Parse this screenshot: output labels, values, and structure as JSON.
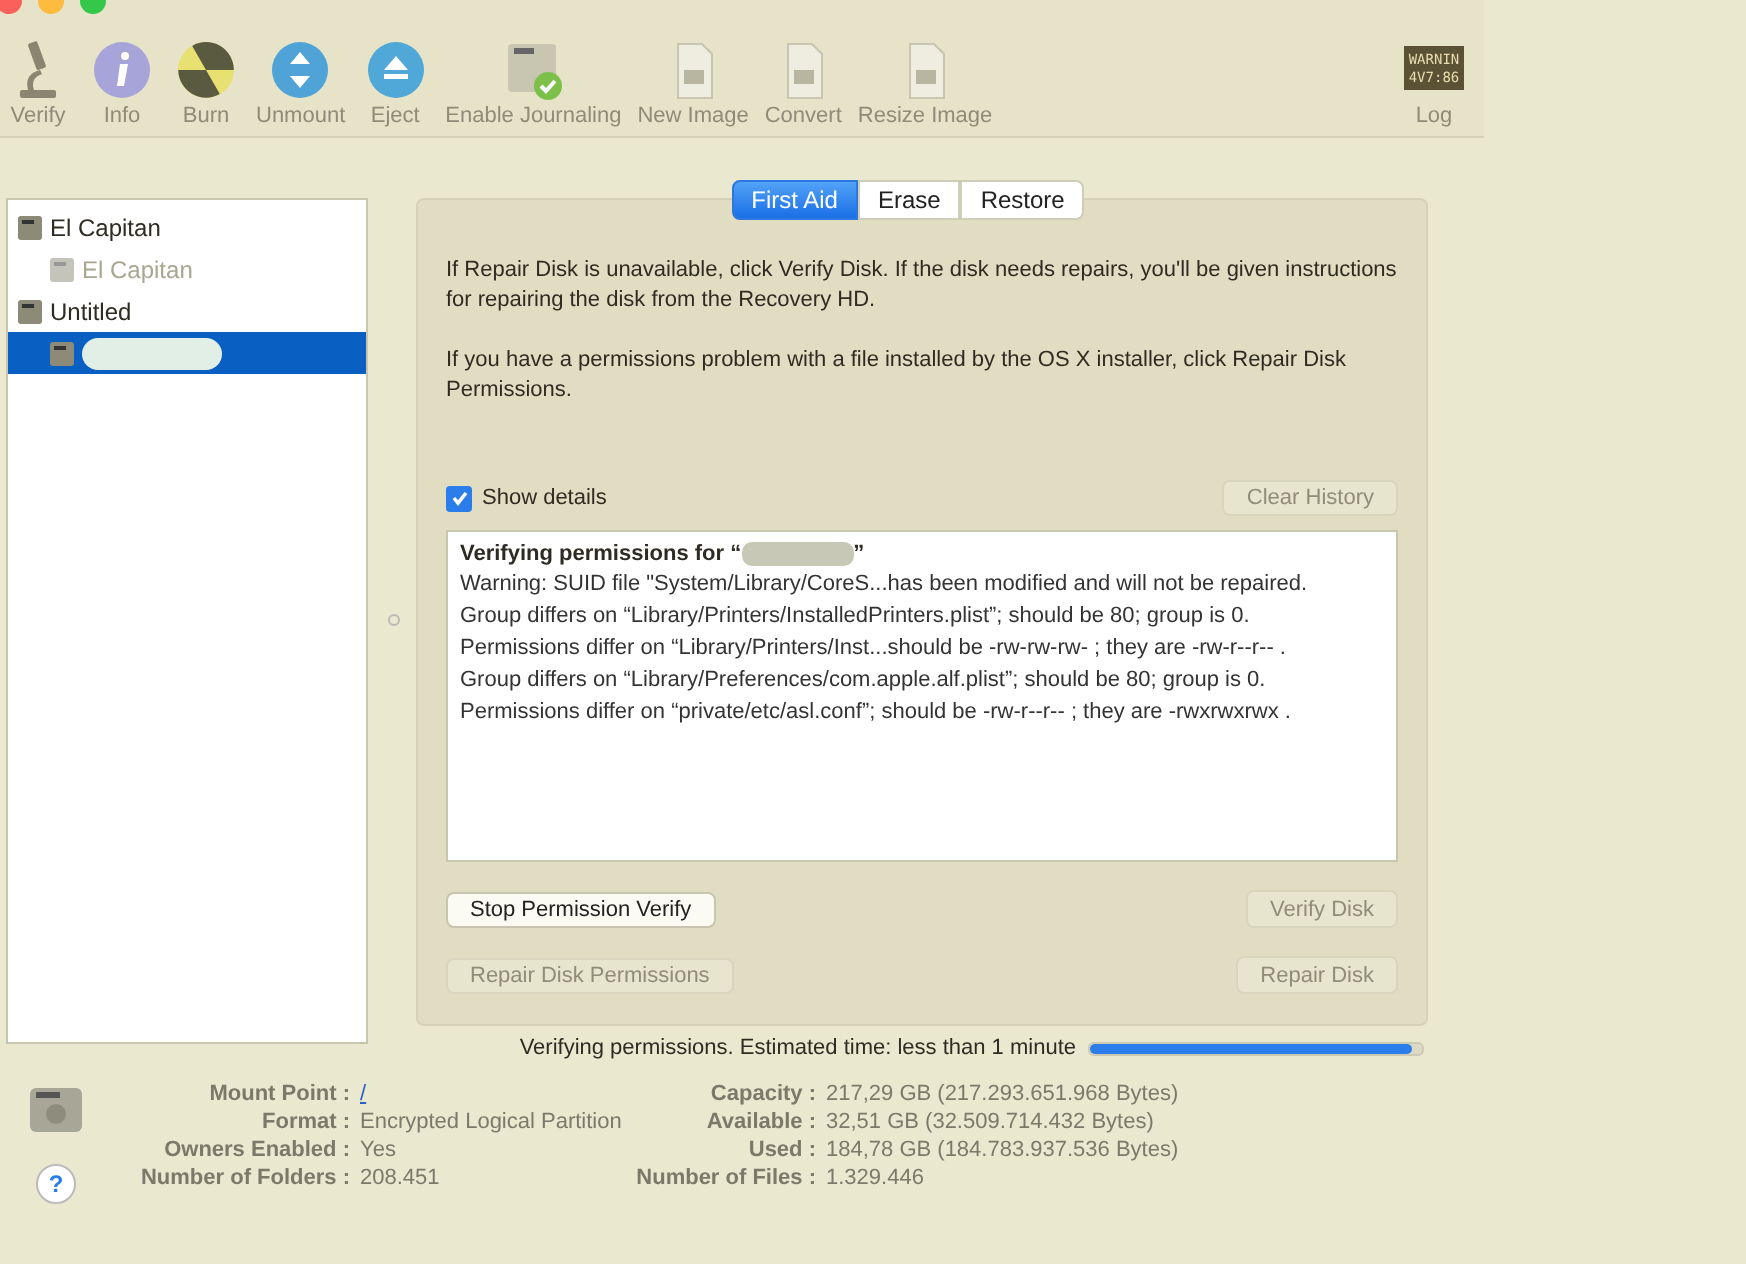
{
  "toolbar": {
    "items": [
      {
        "label": "Verify",
        "kind": "microscope",
        "disabled": false
      },
      {
        "label": "Info",
        "kind": "info",
        "disabled": false
      },
      {
        "label": "Burn",
        "kind": "burn",
        "disabled": false
      },
      {
        "label": "Unmount",
        "kind": "unmount",
        "disabled": false
      },
      {
        "label": "Eject",
        "kind": "eject",
        "disabled": false
      },
      {
        "label": "Enable Journaling",
        "kind": "journal",
        "disabled": false
      },
      {
        "label": "New Image",
        "kind": "newimage",
        "disabled": false
      },
      {
        "label": "Convert",
        "kind": "convert",
        "disabled": false
      },
      {
        "label": "Resize Image",
        "kind": "resize",
        "disabled": false
      }
    ],
    "log": {
      "label": "Log",
      "screen_lines": [
        "WARNIN",
        "4V7:86"
      ]
    }
  },
  "sidebar": {
    "items": [
      {
        "label": "El Capitan",
        "selected": false,
        "dimmed": false,
        "children": [
          {
            "label": "El Capitan",
            "selected": false,
            "dimmed": true,
            "redacted": false
          }
        ]
      },
      {
        "label": "Untitled",
        "selected": false,
        "dimmed": false,
        "children": [
          {
            "selected": true,
            "dimmed": false,
            "redacted": true
          }
        ]
      }
    ]
  },
  "tabs": [
    {
      "label": "First Aid",
      "selected": true
    },
    {
      "label": "Erase",
      "selected": false
    },
    {
      "label": "Restore",
      "selected": false
    }
  ],
  "instructions": [
    "If Repair Disk is unavailable, click Verify Disk. If the disk needs repairs, you'll be given instructions for repairing the disk from the Recovery HD.",
    "If you have a permissions problem with a file installed by the OS X installer, click Repair Disk Permissions."
  ],
  "show_details": {
    "label": "Show details",
    "checked": true
  },
  "clear_history": {
    "label": "Clear History",
    "disabled": true
  },
  "log": {
    "heading_prefix": "Verifying permissions for “",
    "heading_suffix": "”",
    "lines": [
      "Warning: SUID file \"System/Library/CoreS...has been modified and will not be repaired.",
      "Group differs on “Library/Printers/InstalledPrinters.plist”; should be 80; group is 0.",
      "Permissions differ on “Library/Printers/Inst...should be -rw-rw-rw- ; they are -rw-r--r-- .",
      "Group differs on “Library/Preferences/com.apple.alf.plist”; should be 80; group is 0.",
      "Permissions differ on “private/etc/asl.conf”; should be -rw-r--r-- ; they are -rwxrwxrwx ."
    ]
  },
  "buttons": [
    {
      "label": "Stop Permission Verify",
      "disabled": false
    },
    {
      "label": "Verify Disk",
      "disabled": true
    },
    {
      "label": "Repair Disk Permissions",
      "disabled": true
    },
    {
      "label": "Repair Disk",
      "disabled": true
    }
  ],
  "progress": {
    "label": "Verifying permissions. Estimated time: less than 1 minute",
    "level": 0.97
  },
  "info_left": [
    {
      "key": "Mount Point :",
      "value": "/",
      "link": true
    },
    {
      "key": "Format :",
      "value": "Encrypted Logical Partition",
      "link": false
    },
    {
      "key": "Owners Enabled :",
      "value": "Yes",
      "link": false
    },
    {
      "key": "Number of Folders :",
      "value": "208.451",
      "link": false
    }
  ],
  "info_right": [
    {
      "key": "Capacity :",
      "value": "217,29 GB (217.293.651.968 Bytes)"
    },
    {
      "key": "Available :",
      "value": "32,51 GB (32.509.714.432 Bytes)"
    },
    {
      "key": "Used :",
      "value": "184,78 GB (184.783.937.536 Bytes)"
    },
    {
      "key": "Number of Files :",
      "value": "1.329.446"
    }
  ],
  "help": {
    "label": "?"
  }
}
